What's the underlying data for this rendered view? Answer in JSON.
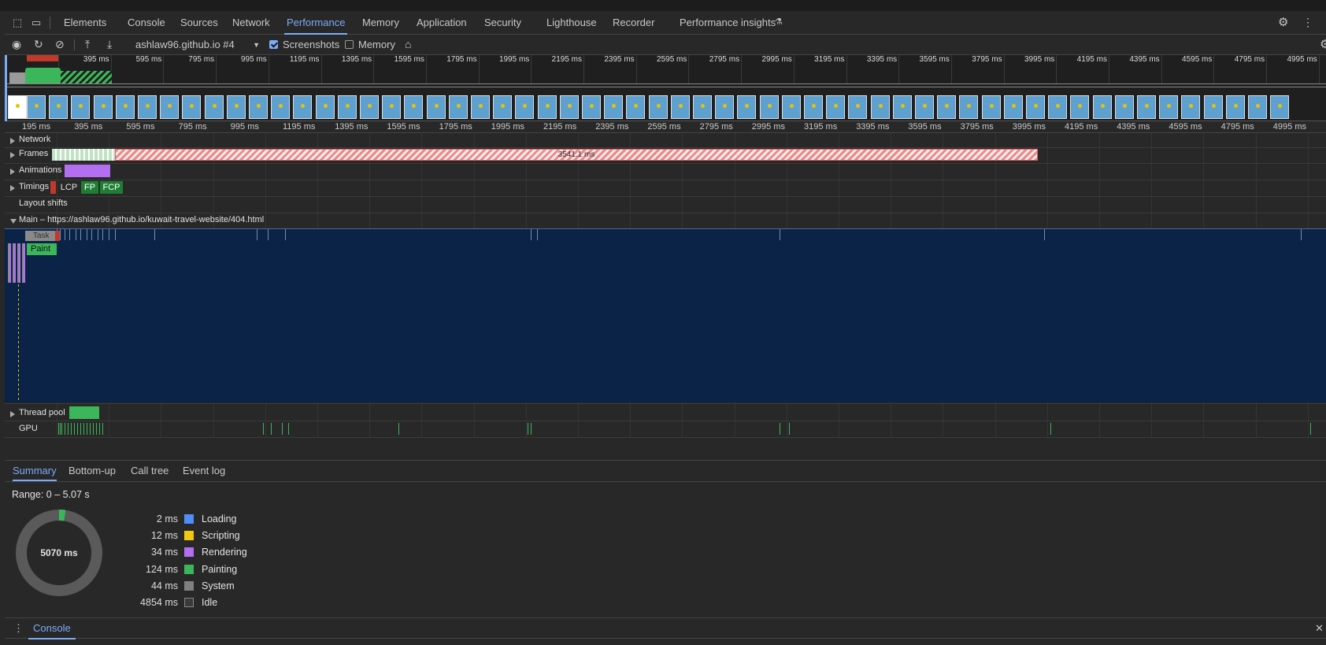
{
  "tabs": [
    {
      "label": "Elements",
      "active": false
    },
    {
      "label": "Console",
      "active": false
    },
    {
      "label": "Sources",
      "active": false
    },
    {
      "label": "Network",
      "active": false
    },
    {
      "label": "Performance",
      "active": true
    },
    {
      "label": "Memory",
      "active": false
    },
    {
      "label": "Application",
      "active": false
    },
    {
      "label": "Security",
      "active": false
    },
    {
      "label": "Lighthouse",
      "active": false
    },
    {
      "label": "Recorder",
      "active": false
    },
    {
      "label": "Performance insights",
      "active": false
    }
  ],
  "toolbar": {
    "profile_select": "ashlaw96.github.io #4",
    "screenshots_label": "Screenshots",
    "screenshots_checked": true,
    "memory_label": "Memory",
    "memory_checked": false
  },
  "overview_ticks": [
    "195 ms",
    "395 ms",
    "595 ms",
    "795 ms",
    "995 ms",
    "1195 ms",
    "1395 ms",
    "1595 ms",
    "1795 ms",
    "1995 ms",
    "2195 ms",
    "2395 ms",
    "2595 ms",
    "2795 ms",
    "2995 ms",
    "3195 ms",
    "3395 ms",
    "3595 ms",
    "3795 ms",
    "3995 ms",
    "4195 ms",
    "4395 ms",
    "4595 ms",
    "4795 ms",
    "4995 ms"
  ],
  "ruler_ticks": [
    "195 ms",
    "395 ms",
    "595 ms",
    "795 ms",
    "995 ms",
    "1195 ms",
    "1395 ms",
    "1595 ms",
    "1795 ms",
    "1995 ms",
    "2195 ms",
    "2395 ms",
    "2595 ms",
    "2795 ms",
    "2995 ms",
    "3195 ms",
    "3395 ms",
    "3595 ms",
    "3795 ms",
    "3995 ms",
    "4195 ms",
    "4395 ms",
    "4595 ms",
    "4795 ms",
    "4995 ms"
  ],
  "tracks": {
    "network": "Network",
    "frames": "Frames",
    "frame_duration": "3541.1 ms",
    "animations": "Animations",
    "timings": "Timings",
    "timing_markers": [
      "LCP",
      "FP",
      "FCP"
    ],
    "layout_shifts": "Layout shifts",
    "main": "Main – https://ashlaw96.github.io/kuwait-travel-website/404.html",
    "task": "Task",
    "paint": "Paint",
    "thread_pool": "Thread pool",
    "gpu": "GPU"
  },
  "bottom_tabs": [
    {
      "label": "Summary",
      "active": true
    },
    {
      "label": "Bottom-up",
      "active": false
    },
    {
      "label": "Call tree",
      "active": false
    },
    {
      "label": "Event log",
      "active": false
    }
  ],
  "summary": {
    "range": "Range: 0 – 5.07 s",
    "total": "5070 ms",
    "items": [
      {
        "value": "2 ms",
        "label": "Loading",
        "color": "#4f8ef7"
      },
      {
        "value": "12 ms",
        "label": "Scripting",
        "color": "#f2c80f"
      },
      {
        "value": "34 ms",
        "label": "Rendering",
        "color": "#b36ef2"
      },
      {
        "value": "124 ms",
        "label": "Painting",
        "color": "#3cb65a"
      },
      {
        "value": "44 ms",
        "label": "System",
        "color": "#808080"
      },
      {
        "value": "4854 ms",
        "label": "Idle",
        "color": "#3a3a3a"
      }
    ]
  },
  "drawer": {
    "tab": "Console"
  },
  "colors": {
    "accent": "#7cacf8",
    "main_thread_bg": "#0b2346",
    "frame_bar": "#e88a8a",
    "animation": "#b36ef2",
    "paint": "#3cb65a"
  }
}
